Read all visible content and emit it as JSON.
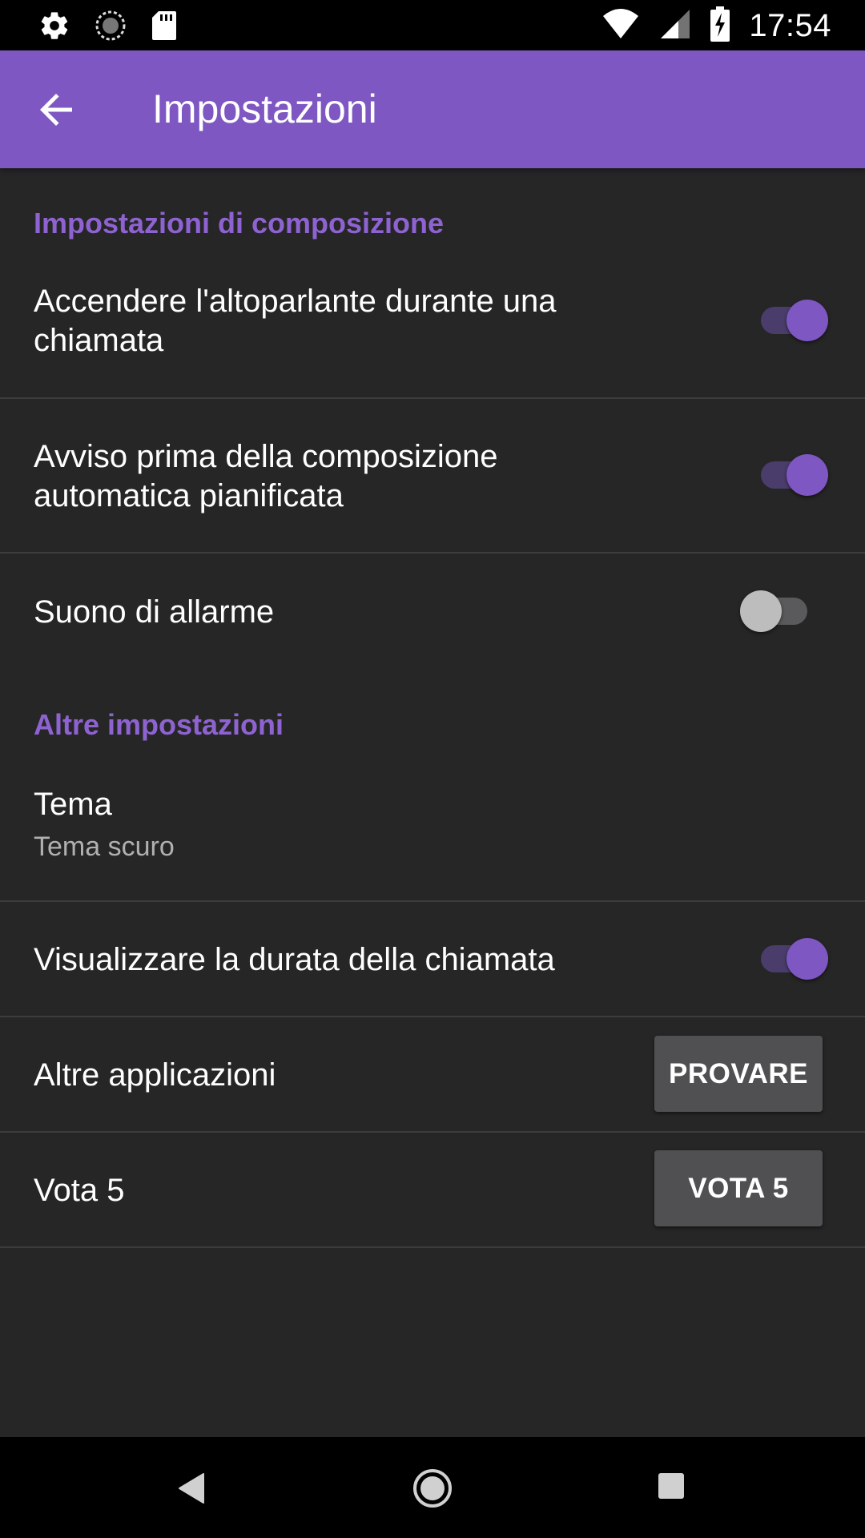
{
  "status_bar": {
    "time": "17:54",
    "left_icons": [
      "gear-icon",
      "sync-icon",
      "sd-card-icon"
    ],
    "right_icons": [
      "wifi-icon",
      "cell-signal-icon",
      "battery-charging-icon"
    ]
  },
  "app_bar": {
    "title": "Impostazioni",
    "color": "#7e57c2"
  },
  "sections": {
    "dialing": {
      "header": "Impostazioni di composizione"
    },
    "other": {
      "header": "Altre impostazioni"
    }
  },
  "settings": {
    "speaker": {
      "title": "Accendere l'altoparlante durante una chiamata",
      "enabled": true
    },
    "warning": {
      "title": "Avviso prima della composizione automatica pianificata",
      "enabled": true
    },
    "alarm": {
      "title": "Suono di allarme",
      "enabled": false
    },
    "theme": {
      "title": "Tema",
      "summary": "Tema scuro"
    },
    "duration": {
      "title": "Visualizzare la durata della chiamata",
      "enabled": true
    },
    "other_apps": {
      "title": "Altre applicazioni",
      "button": "PROVARE"
    },
    "rate": {
      "title": "Vota 5",
      "button": "VOTA 5"
    }
  },
  "colors": {
    "accent": "#7e57c2",
    "background": "#262627"
  }
}
